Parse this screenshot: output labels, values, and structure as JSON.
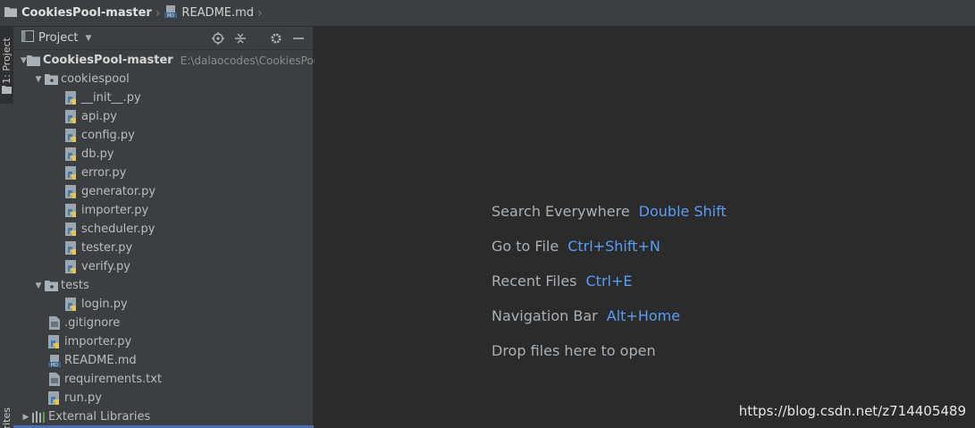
{
  "navbar": {
    "project": "CookiesPool-master",
    "file": "README.md"
  },
  "strip": {
    "project_tab": "1: Project",
    "favorites_tab": "orites"
  },
  "panel": {
    "title": "Project",
    "tools": [
      "target-icon",
      "collapse-icon",
      "gear-icon",
      "minimize-icon"
    ]
  },
  "tree": {
    "root": {
      "label": "CookiesPool-master",
      "path": "E:\\dalaocodes\\CookiesPool-"
    },
    "cookiespool": {
      "label": "cookiespool",
      "files": [
        "__init__.py",
        "api.py",
        "config.py",
        "db.py",
        "error.py",
        "generator.py",
        "importer.py",
        "scheduler.py",
        "tester.py",
        "verify.py"
      ]
    },
    "tests": {
      "label": "tests",
      "files": [
        "login.py"
      ]
    },
    "root_files": [
      ".gitignore",
      "importer.py",
      "README.md",
      "requirements.txt",
      "run.py"
    ],
    "external": "External Libraries"
  },
  "editor": {
    "hints": [
      {
        "label": "Search Everywhere",
        "key": "Double Shift"
      },
      {
        "label": "Go to File",
        "key": "Ctrl+Shift+N"
      },
      {
        "label": "Recent Files",
        "key": "Ctrl+E"
      },
      {
        "label": "Navigation Bar",
        "key": "Alt+Home"
      },
      {
        "label": "Drop files here to open",
        "key": ""
      }
    ],
    "watermark": "https://blog.csdn.net/z714405489"
  },
  "colors": {
    "accent": "#589df6",
    "panel_bg": "#3c3f41",
    "editor_bg": "#2b2b2b",
    "selection": "#4b6eaf"
  }
}
